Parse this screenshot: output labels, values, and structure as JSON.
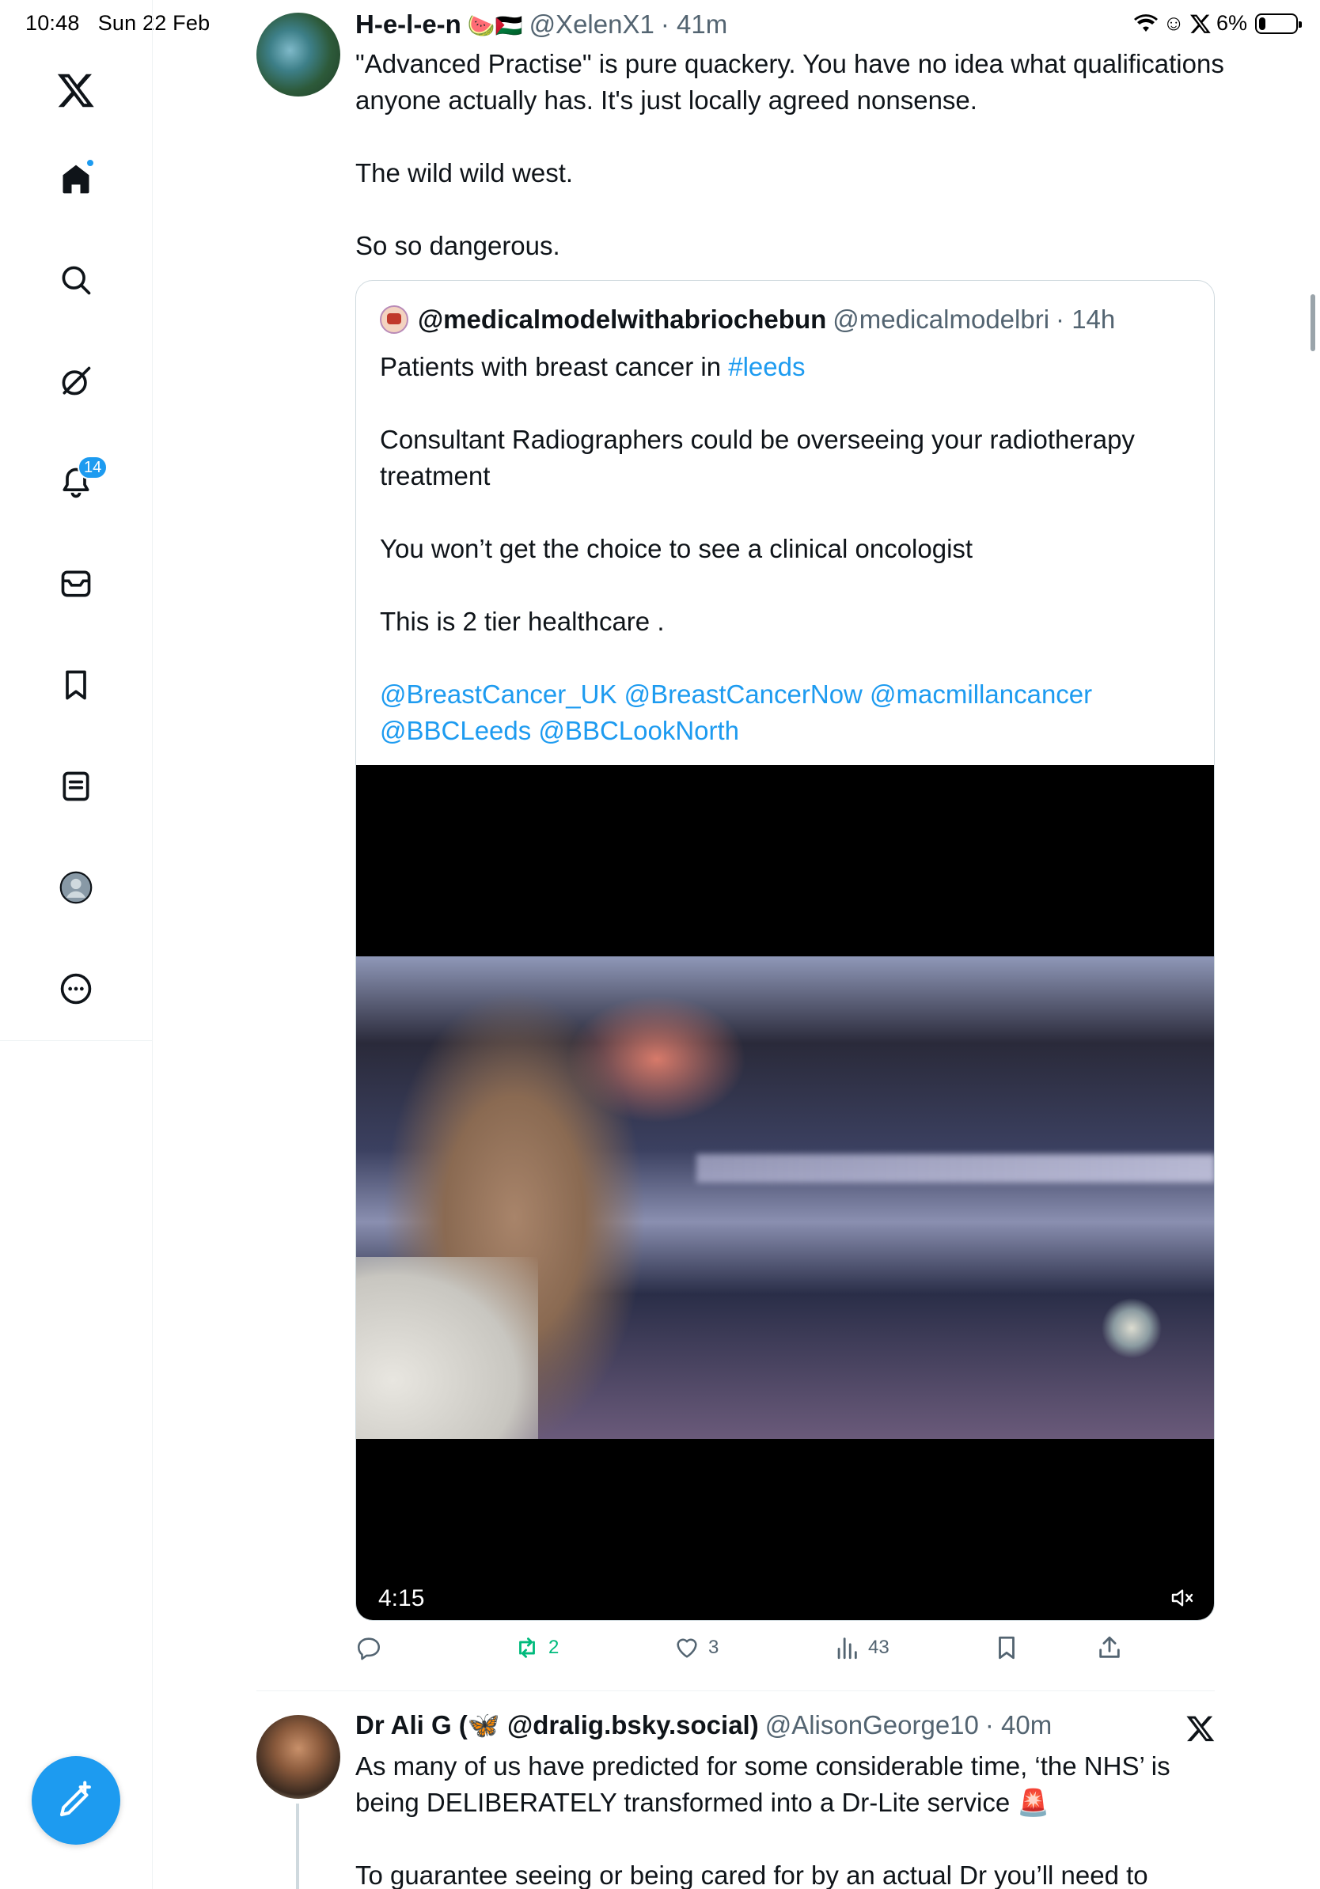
{
  "status_bar": {
    "time": "10:48",
    "date": "Sun 22 Feb",
    "battery_text": "6%",
    "battery_level": 0.06
  },
  "sidebar": {
    "items": [
      {
        "name": "x-logo-icon"
      },
      {
        "name": "home-icon"
      },
      {
        "name": "search-icon"
      },
      {
        "name": "grok-icon"
      },
      {
        "name": "notifications-icon",
        "badge": "14"
      },
      {
        "name": "messages-icon"
      },
      {
        "name": "bookmarks-icon"
      },
      {
        "name": "lists-icon"
      },
      {
        "name": "profile-icon"
      },
      {
        "name": "more-icon"
      }
    ],
    "compose_icon": "compose-icon"
  },
  "tweet1": {
    "name": "H-e-l-e-n",
    "emojis": "🍉🇵🇸",
    "handle": "@XelenX1",
    "time": "· 41m",
    "paragraphs": [
      "\"Advanced Practise\" is pure quackery. You have no idea what qualifications anyone actually has. It's just locally agreed nonsense.",
      "The wild wild west.",
      "So so dangerous."
    ],
    "quote": {
      "name": "@medicalmodelwithabriochebun",
      "handle": "@medicalmodelbri",
      "time": "· 14h",
      "line1_prefix": "Patients with breast cancer in ",
      "line1_tag": "#leeds",
      "para2": "Consultant Radiographers could be overseeing your radiotherapy treatment",
      "para3": "You won’t get the choice to see a clinical oncologist",
      "para4": "This is 2 tier healthcare .",
      "mentions_line1": "@BreastCancer_UK @BreastCancerNow @macmillancancer",
      "mentions_line2": "@BBCLeeds @BBCLookNorth",
      "video_duration": "4:15"
    },
    "actions": {
      "replies": "",
      "reposts": "2",
      "likes": "3",
      "views": "43"
    }
  },
  "tweet2": {
    "name": "Dr Ali G (🦋 @dralig.bsky.social)",
    "handle": "@AlisonGeorge10",
    "time": "· 40m",
    "line1": "As many of us have predicted for some considerable time, ‘the NHS’ is",
    "line2": "being DELIBERATELY transformed into a Dr-Lite service 🚨",
    "line3": "To guarantee seeing or being cared for by an actual Dr you’ll need to"
  },
  "colors": {
    "accent": "#1d9bf0",
    "repost_green": "#00ba7c",
    "secondary_text": "#536471",
    "border": "#cfd9de"
  }
}
